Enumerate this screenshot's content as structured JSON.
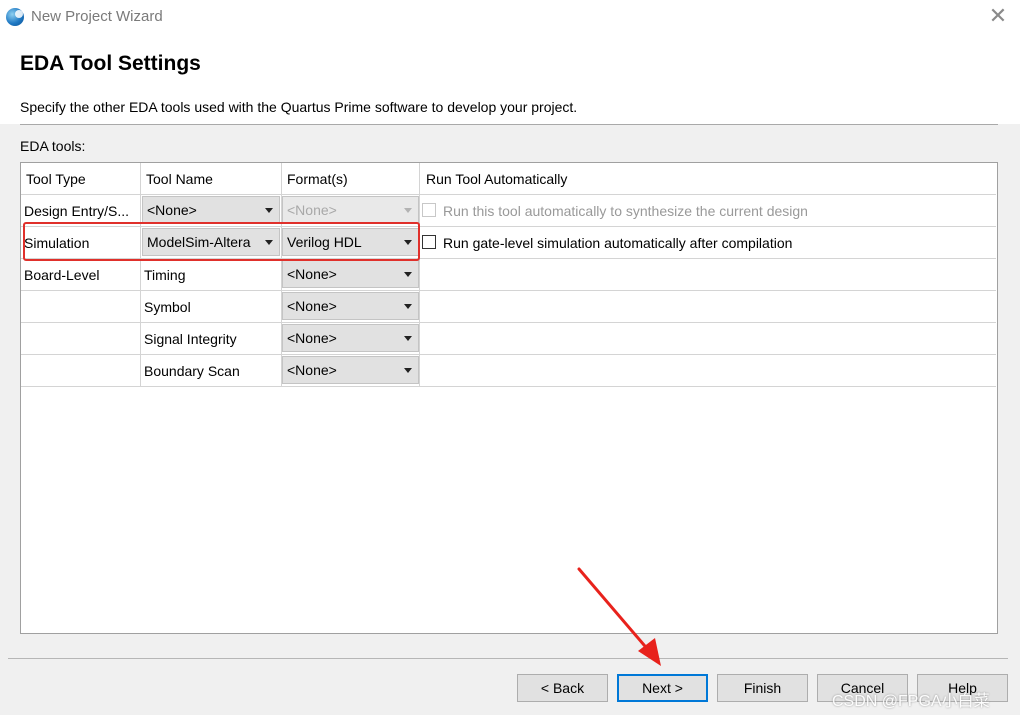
{
  "window": {
    "title": "New Project Wizard",
    "close_label": "✕"
  },
  "header": {
    "heading": "EDA Tool Settings",
    "description": "Specify the other EDA tools used with the Quartus Prime software to develop your project."
  },
  "eda_label": "EDA tools:",
  "table": {
    "columns": [
      "Tool Type",
      "Tool Name",
      "Format(s)",
      "Run Tool Automatically"
    ],
    "rows": [
      {
        "tool_type": "Design Entry/S...",
        "tool_name": "<None>",
        "format": "<None>",
        "format_disabled": true,
        "run_label": "Run this tool automatically to synthesize the current design",
        "run_checked": false,
        "run_disabled": true
      },
      {
        "tool_type": "Simulation",
        "tool_name": "ModelSim-Altera",
        "format": "Verilog HDL",
        "run_label": "Run gate-level simulation automatically after compilation",
        "run_checked": false,
        "run_disabled": false
      },
      {
        "tool_type": "Board-Level",
        "tool_name": "Timing",
        "format": "<None>"
      },
      {
        "tool_type": "",
        "tool_name": "Symbol",
        "format": "<None>"
      },
      {
        "tool_type": "",
        "tool_name": "Signal Integrity",
        "format": "<None>"
      },
      {
        "tool_type": "",
        "tool_name": "Boundary Scan",
        "format": "<None>"
      }
    ]
  },
  "buttons": {
    "back": "< Back",
    "next": "Next >",
    "finish": "Finish",
    "cancel": "Cancel",
    "help": "Help"
  },
  "watermark": "CSDN @FPGA小白菜",
  "colors": {
    "highlight": "#e0302b",
    "default_button_border": "#0078d7"
  }
}
